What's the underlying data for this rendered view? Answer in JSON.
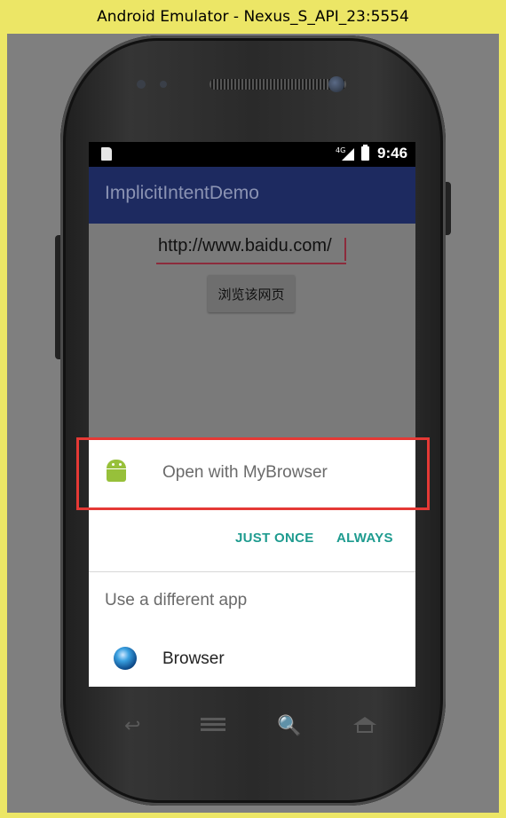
{
  "window": {
    "title": "Android Emulator - Nexus_S_API_23:5554"
  },
  "statusbar": {
    "network_label": "4G",
    "time": "9:46"
  },
  "app": {
    "title": "ImplicitIntentDemo",
    "url_value": "http://www.baidu.com/",
    "browse_button_label": "浏览该网页"
  },
  "chooser": {
    "open_with_label": "Open with MyBrowser",
    "just_once_label": "JUST ONCE",
    "always_label": "ALWAYS",
    "different_app_label": "Use a different app",
    "apps": [
      {
        "name": "Browser",
        "icon": "globe-icon"
      }
    ]
  },
  "nav_keys": {
    "back": "↩",
    "search": "🔍"
  },
  "colors": {
    "appbar": "#1d2a60",
    "accent": "#1e9b8f",
    "highlight": "#e53935"
  }
}
